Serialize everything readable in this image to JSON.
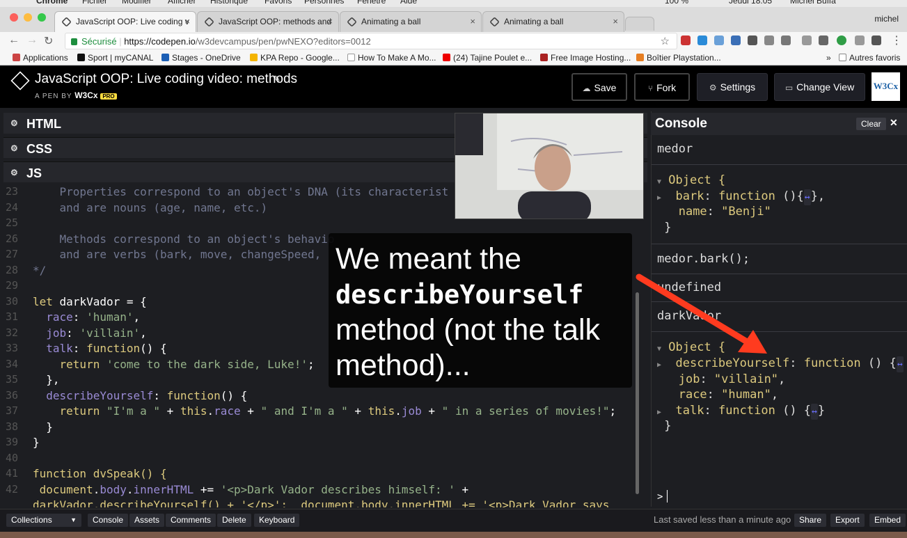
{
  "os_menu": [
    "Chrome",
    "Fichier",
    "Modifier",
    "Afficher",
    "Historique",
    "Favoris",
    "Personnes",
    "Fenêtre",
    "Aide",
    "100 %",
    "Jeudi 18:05",
    "Michel Buffa"
  ],
  "browser": {
    "tabs": [
      {
        "label": "JavaScript OOP: Live coding v",
        "active": true
      },
      {
        "label": "JavaScript OOP: methods and",
        "active": false
      },
      {
        "label": "Animating a ball",
        "active": false
      },
      {
        "label": "Animating a ball",
        "active": false
      }
    ],
    "user": "michel",
    "secure_label": "Sécurisé",
    "url_domain": "https://codepen.io",
    "url_path": "/w3devcampus/pen/pwNEXO?editors=0012",
    "bookmarks": [
      {
        "label": "Applications",
        "icon": "grid-icon"
      },
      {
        "label": "Sport | myCANAL",
        "icon": "plus-icon"
      },
      {
        "label": "Stages - OneDrive",
        "icon": "cloud-icon"
      },
      {
        "label": "KPA Repo - Google...",
        "icon": "drive-icon"
      },
      {
        "label": "How To Make A Mo...",
        "icon": "page-icon"
      },
      {
        "label": "(24) Tajine Poulet e...",
        "icon": "youtube-icon"
      },
      {
        "label": "Free Image Hosting...",
        "icon": "image-icon"
      },
      {
        "label": "Boîtier Playstation...",
        "icon": "shop-icon"
      }
    ],
    "bookmarks_more": "»",
    "other_bookmarks": "Autres favoris"
  },
  "pen": {
    "title": "JavaScript OOP: Live coding video: methods",
    "by_label": "A PEN BY",
    "author": "W3Cx",
    "pro_badge": "PRO",
    "buttons": {
      "save": "Save",
      "fork": "Fork",
      "settings": "Settings",
      "change_view": "Change View"
    },
    "logo_text": "W3Cx"
  },
  "editors": {
    "html": "HTML",
    "css": "CSS",
    "js": "JS"
  },
  "code_lines": [
    "23",
    "24",
    "25",
    "26",
    "27",
    "28",
    "29",
    "30",
    "31",
    "32",
    "33",
    "34",
    "35",
    "36",
    "37",
    "38",
    "39",
    "40",
    "41",
    "42"
  ],
  "code": {
    "l23": "    Properties correspond to an object's DNA (its characterist",
    "l24": "    and are nouns (age, name, etc.)",
    "l26": "    Methods correspond to an object's behavio",
    "l27": "    and are verbs (bark, move, changeSpeed, ",
    "l28": "*/",
    "l30_kw": "let",
    "l30_rest": " darkVador = {",
    "l31_p": "  race",
    "l31_v": "'human'",
    "l32_p": "  job",
    "l32_v": "'villain'",
    "l33_p": "  talk",
    "l33_f": "function",
    "l33_r": "() {",
    "l34_kw": "    return",
    "l34_v": "'come to the dark side, Luke!'",
    "l35": "  },",
    "l36_p": "  describeYourself",
    "l36_f": "function",
    "l36_r": "() {",
    "l37_kw": "    return",
    "l37_s1": "\"I'm a \"",
    "l37_t1": "this",
    "l37_p1": "race",
    "l37_s2": "\" and I'm a \"",
    "l37_t2": "this",
    "l37_p2": "job",
    "l37_s3": "\" in a series of movies!\"",
    "l38": "  }",
    "l39": "}",
    "l41_kw": "function",
    "l41_rest": " dvSpeak() {",
    "l42_a": " document",
    "l42_b": "body",
    "l42_c": "innerHTML",
    "l42_s": "'<p>Dark Vador describes himself: '",
    "l43": "darkVador.describeYourself() + '</p>';  document.body.innerHTML += '<p>Dark Vador says"
  },
  "caption": {
    "line1": "We meant the",
    "line2": "describeYourself",
    "line3": "method (not the talk",
    "line4": "method)..."
  },
  "console": {
    "title": "Console",
    "clear": "Clear",
    "close": "✕",
    "entry1_input": "medor",
    "entry1_obj": "Object {",
    "entry1_k1": "bark",
    "entry1_v1": "function",
    "entry1_v1b": " (){",
    "entry1_k2": "name",
    "entry1_v2": "\"Benji\"",
    "entry1_close": "}",
    "entry2_input": "medor.bark();",
    "entry2_output": "undefined",
    "entry3_input": "darkVador",
    "entry3_obj": "Object {",
    "entry3_k1": "describeYourself",
    "entry3_v1": "function",
    "entry3_v1b": " () {",
    "entry3_k2": "job",
    "entry3_v2": "\"villain\"",
    "entry3_k3": "race",
    "entry3_v3": "\"human\"",
    "entry3_k4": "talk",
    "entry3_v4": "function",
    "entry3_v4b": " () {",
    "entry3_close": "}",
    "ellipsis": "↔",
    "prompt": ">"
  },
  "footer": {
    "collections": "Collections",
    "console": "Console",
    "assets": "Assets",
    "comments": "Comments",
    "delete": "Delete",
    "keyboard": "Keyboard",
    "saved": "Last saved less than a minute ago",
    "share": "Share",
    "export": "Export",
    "embed": "Embed"
  },
  "colors": {
    "accent_red": "#ff3b1f",
    "codepen_bg": "#1d1e22",
    "pro_yellow": "#ffdd40"
  }
}
